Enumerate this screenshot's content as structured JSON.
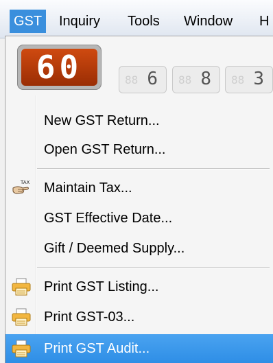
{
  "menubar": {
    "gst": "GST",
    "inquiry": "Inquiry",
    "tools": "Tools",
    "window": "Window",
    "help": "H"
  },
  "counters": {
    "main": "60",
    "small": [
      "6",
      "8",
      "3"
    ]
  },
  "gst_menu": {
    "new_return": "New GST Return...",
    "open_return": "Open GST Return...",
    "maintain_tax": "Maintain Tax...",
    "effective_date": "GST Effective Date...",
    "gift_supply": "Gift / Deemed Supply...",
    "print_listing": "Print GST Listing...",
    "print_gst03": "Print GST-03...",
    "print_audit": "Print GST Audit..."
  },
  "colors": {
    "highlight": "#3a8fdd",
    "counter": "#b53a07"
  },
  "icons": {
    "maintain_tax": "tax-hand-icon",
    "print": "printer-icon"
  }
}
